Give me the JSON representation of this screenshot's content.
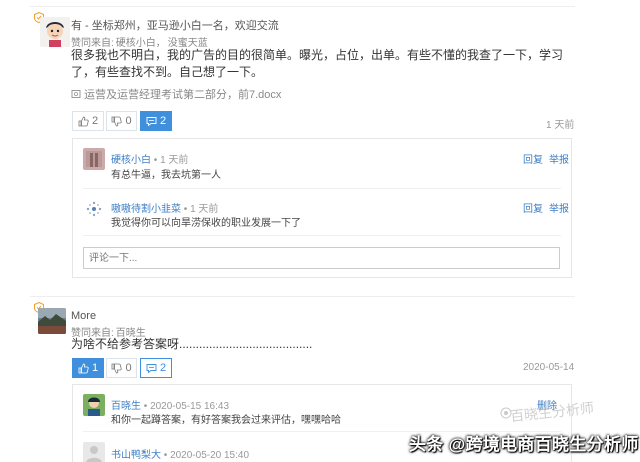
{
  "post1": {
    "author": "有 - 坐标郑州，亚马逊小白一名，欢迎交流",
    "liked_prefix": "赞同来自:",
    "likers": [
      "硬核小白",
      "没蜜天蓝"
    ],
    "content": "很多我也不明白，我的广告的目的很简单。曝光，占位，出单。有些不懂的我查了一下，学习了，有些查找不到。自己想了一下。",
    "attachment": "运营及运营经理考试第二部分，前7.docx",
    "like_count": "2",
    "dislike_count": "0",
    "comment_count": "2",
    "time": "1 天前",
    "replies": [
      {
        "name": "硬核小白",
        "time": "1 天前",
        "text": "有总牛逼，我去坑第一人",
        "actions": [
          "回复",
          "举报"
        ]
      },
      {
        "name": "嗷嗷待割小韭菜",
        "time": "1 天前",
        "text": "我觉得你可以向旱涝保收的职业发展一下了",
        "actions": [
          "回复",
          "举报"
        ]
      }
    ],
    "comment_placeholder": "评论一下..."
  },
  "post2": {
    "author": "More",
    "liked_prefix": "赞同来自:",
    "likers": [
      "百晓生"
    ],
    "content": "为啥不给参考答案呀........................................",
    "like_count": "1",
    "dislike_count": "0",
    "comment_count": "2",
    "time": "2020-05-14",
    "replies": [
      {
        "name": "百晓生",
        "time": "2020-05-15 16:43",
        "text": "和你一起蹲答案，有好答案我会过来评估，嘿嘿哈哈",
        "actions": [
          "删除"
        ]
      },
      {
        "name": "书山鸭梨大",
        "time": "2020-05-20 15:40",
        "text": "",
        "actions": []
      }
    ]
  },
  "watermark": {
    "text": "头条 @跨境电商百晓生分析师",
    "ghost": "百晓生分析师"
  },
  "colors": {
    "accent": "#3f8fdc",
    "link": "#3f7fc5"
  }
}
